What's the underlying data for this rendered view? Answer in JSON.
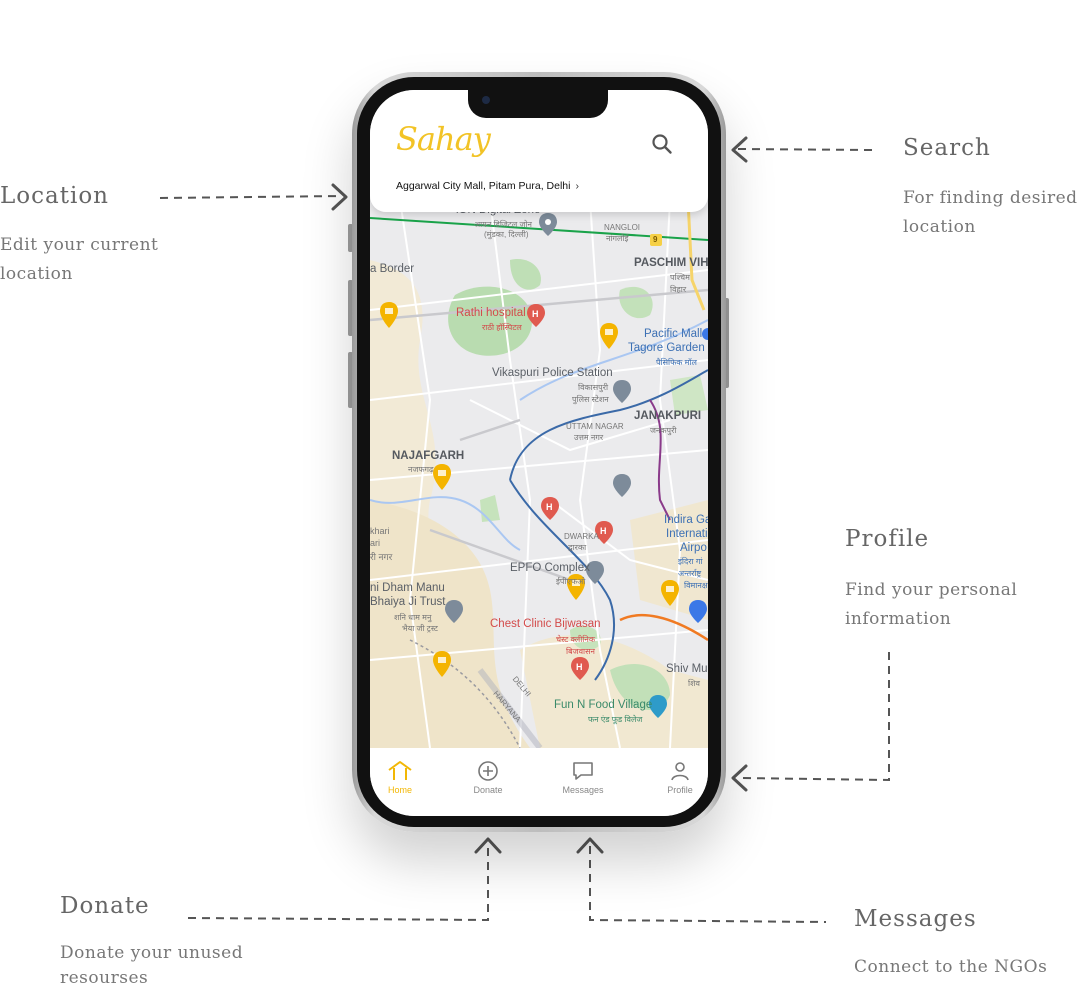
{
  "annotations": {
    "location": {
      "title": "Location",
      "desc_line1": "Edit your current",
      "desc_line2": "location"
    },
    "search": {
      "title": "Search",
      "desc_line1": "For finding desired",
      "desc_line2": "location"
    },
    "profile": {
      "title": "Profile",
      "desc_line1": "Find your personal",
      "desc_line2": "information"
    },
    "donate": {
      "title": "Donate",
      "desc_line1": "Donate your unused",
      "desc_line2": "resourses"
    },
    "messages": {
      "title": "Messages",
      "desc_line1": "Connect  to the NGOs"
    }
  },
  "app": {
    "logo": "Sahay",
    "location_text": "Aggarwal City Mall, Pitam Pura, Delhi",
    "location_chevron": "›"
  },
  "map_labels": {
    "ion": "iON Digital Zone",
    "ion_hi": "आयन डिजिटल जोन",
    "ion_hi2": "(मुंडका, दिल्ली)",
    "nangloi": "NANGLOI",
    "nangloi_hi": "नांगलोई",
    "route9": "9",
    "paschim": "PASCHIM VIH",
    "paschim_hi": "पश्चिम",
    "paschim_hi2": "विहार",
    "border": "a Border",
    "rathi": "Rathi hospital",
    "rathi_hi": "राठी हॉस्पिटल",
    "pacific": "Pacific Mall",
    "tagore": "Tagore Garden",
    "pacific_hi": "पैसिफिक मॉल",
    "vikaspuri": "Vikaspuri Police Station",
    "vikaspuri_hi": "विकासपुरी",
    "vikaspuri_hi2": "पुलिस स्टेशन",
    "uttam": "UTTAM NAGAR",
    "uttam_hi": "उत्तम नगर",
    "janakpuri": "JANAKPURI",
    "janakpuri_hi": "जनकपुरी",
    "najafgarh": "NAJAFGARH",
    "najafgarh_hi": "नजफगढ़",
    "dwarka": "DWARKA",
    "dwarka_hi": "द्वारका",
    "indira1": "Indira Ga",
    "indira2": "Internati",
    "indira3": "Airpo",
    "indira_hi": "इंदिरा गां",
    "indira_hi2": "अन्तर्राष्ट्र",
    "indira_hi3": "विमानक्ष",
    "kharim": "khari",
    "kharim2": "ari",
    "kharim3": "री नगर",
    "epfo": "EPFO Complex",
    "epfo_hi": "ईपीएफओ",
    "dham1": "ni Dham Manu",
    "dham2": "Bhaiya Ji Trust",
    "dham_hi": "शनि धाम मनु",
    "dham_hi2": "भैया जी ट्रस्ट",
    "chest": "Chest Clinic Bijwasan",
    "chest_hi": "चेस्ट क्लीनिक",
    "chest_hi2": "बिजवासन",
    "shiv": "Shiv Mu",
    "shiv_hi": "शिव",
    "delhi": "DELHI",
    "haryana": "HARYANA",
    "funn": "Fun N Food Village",
    "funn_hi": "फन एंड फूड विलेज"
  },
  "nav": {
    "home": "Home",
    "donate": "Donate",
    "messages": "Messages",
    "profile": "Profile"
  },
  "colors": {
    "brand_yellow": "#f2c326",
    "pin_yellow": "#f4b400",
    "hospital_red": "#e05a4f"
  }
}
